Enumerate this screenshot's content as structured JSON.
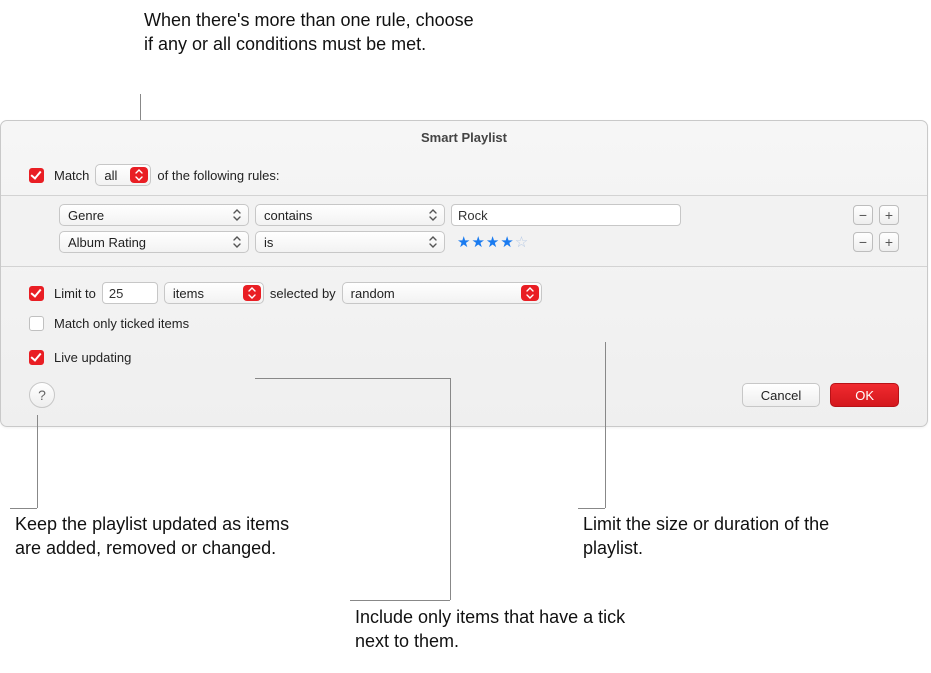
{
  "callouts": {
    "top": "When there's more than one rule, choose if any or all conditions must be met.",
    "left": "Keep the playlist updated as items are added, removed or changed.",
    "middle": "Include only items that have a tick next to them.",
    "right": "Limit the size or duration of the playlist."
  },
  "header": {
    "title": "Smart Playlist"
  },
  "match": {
    "label_pre": "Match",
    "mode": "all",
    "label_post": "of the following rules:"
  },
  "rules": [
    {
      "field": "Genre",
      "op": "contains",
      "value": "Rock",
      "value_type": "text"
    },
    {
      "field": "Album Rating",
      "op": "is",
      "stars": 4,
      "value_type": "stars"
    }
  ],
  "limit": {
    "label_pre": "Limit to",
    "value": "25",
    "unit": "items",
    "label_mid": "selected by",
    "method": "random"
  },
  "ticked": {
    "label": "Match only ticked items"
  },
  "live": {
    "label": "Live updating"
  },
  "buttons": {
    "cancel": "Cancel",
    "ok": "OK",
    "help": "?"
  },
  "icons": {
    "minus": "−",
    "plus": "+"
  }
}
